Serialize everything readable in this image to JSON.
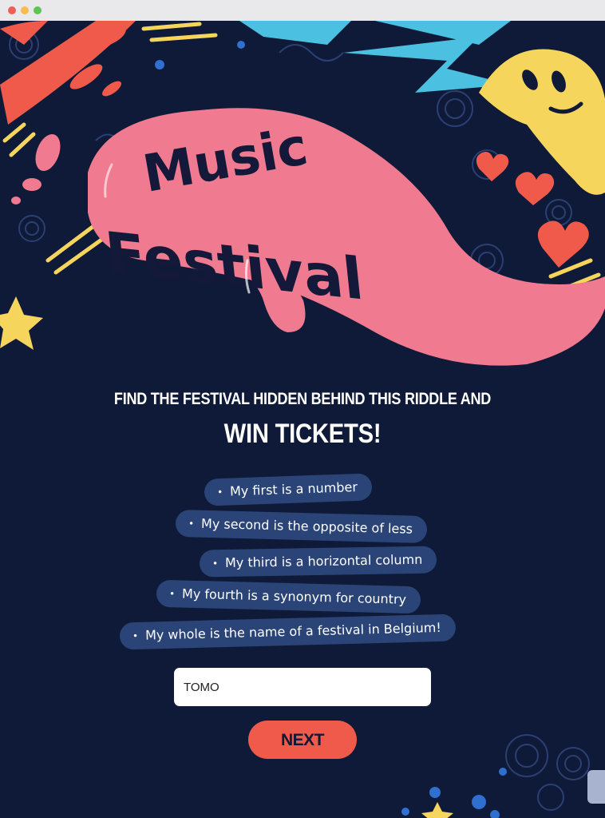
{
  "window": {
    "controls": [
      "close",
      "minimize",
      "maximize"
    ]
  },
  "hero": {
    "title_line1": "Music",
    "title_line2": "Festival"
  },
  "headline": {
    "line1": "FIND THE FESTIVAL HIDDEN BEHIND THIS RIDDLE AND",
    "line2": "WIN TICKETS!"
  },
  "riddle": [
    {
      "bullet": "•",
      "text": "My first is a number"
    },
    {
      "bullet": "•",
      "text": "My second is the opposite of less"
    },
    {
      "bullet": "•",
      "text": "My third is a horizontal column"
    },
    {
      "bullet": "•",
      "text": "My fourth is a synonym for country"
    },
    {
      "bullet": "•",
      "text": "My whole is the name of a festival in Belgium!"
    }
  ],
  "answer": {
    "value": "TOMO"
  },
  "next_button": {
    "label": "NEXT"
  },
  "colors": {
    "background": "#0f1a38",
    "pill": "#2a4478",
    "banner_pink": "#f07a90",
    "accent_coral": "#ef5a4a",
    "accent_yellow": "#f6d55c",
    "accent_cyan": "#4cc0e0"
  }
}
